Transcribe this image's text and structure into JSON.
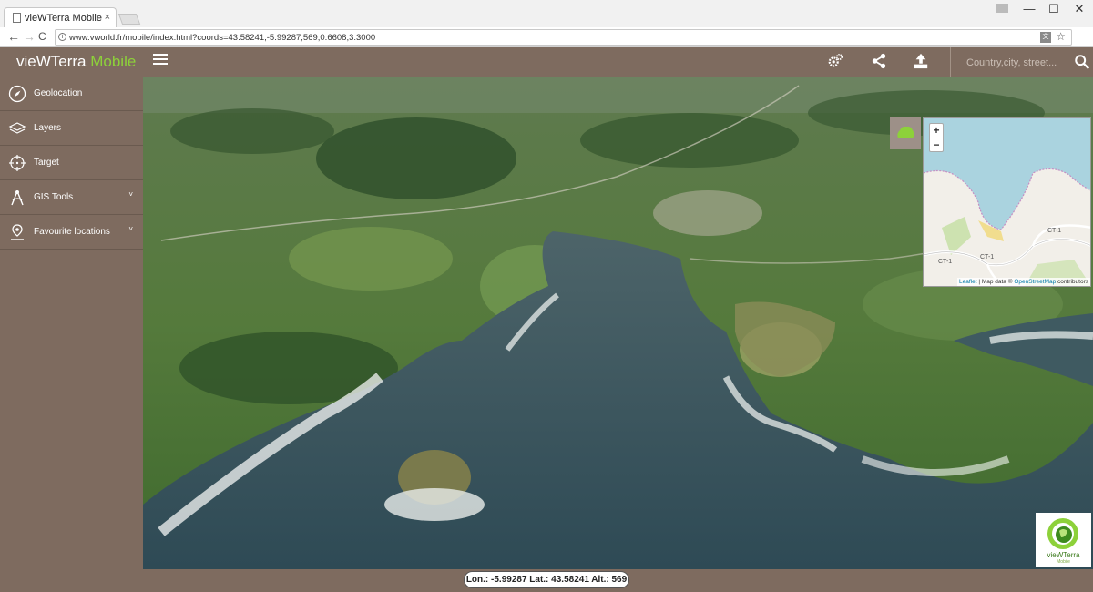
{
  "browser": {
    "tab_title": "vieWTerra Mobile",
    "tab_close": "×",
    "url": "www.vworld.fr/mobile/index.html?coords=43.58241,-5.99287,569,0.6608,3.3000",
    "window_controls": {
      "minimize": "—",
      "maximize": "☐",
      "close": "✕"
    },
    "nav": {
      "back": "←",
      "forward": "→",
      "reload": "C"
    }
  },
  "app": {
    "brand_main": "vieWTerra ",
    "brand_accent": "Mobile",
    "search_placeholder": "Country,city, street...",
    "header_icons": [
      "settings-gears-icon",
      "share-icon",
      "upload-icon",
      "search-icon"
    ]
  },
  "sidebar": {
    "items": [
      {
        "label": "Geolocation",
        "icon": "compass-icon",
        "expandable": false
      },
      {
        "label": "Layers",
        "icon": "layers-icon",
        "expandable": false
      },
      {
        "label": "Target",
        "icon": "crosshair-icon",
        "expandable": false
      },
      {
        "label": "GIS Tools",
        "icon": "gis-tools-icon",
        "expandable": true
      },
      {
        "label": "Favourite locations",
        "icon": "map-pin-icon",
        "expandable": true
      }
    ]
  },
  "minimap": {
    "zoom_in": "+",
    "zoom_out": "−",
    "road_labels": [
      "CT-1",
      "CT-1",
      "CT-1"
    ],
    "attribution": {
      "leaflet": "Leaflet",
      "sep": " | Map data © ",
      "osm": "OpenStreetMap",
      "rest": " contributors"
    }
  },
  "status": {
    "coordinates": "Lon.: -5.99287  Lat.: 43.58241  Alt.: 569"
  },
  "logo": {
    "name": "vieWTerra",
    "sub": "Mobile"
  },
  "colors": {
    "panel": "#7e6b5f",
    "accent": "#8dd13a",
    "sea": "#3f5a61"
  }
}
